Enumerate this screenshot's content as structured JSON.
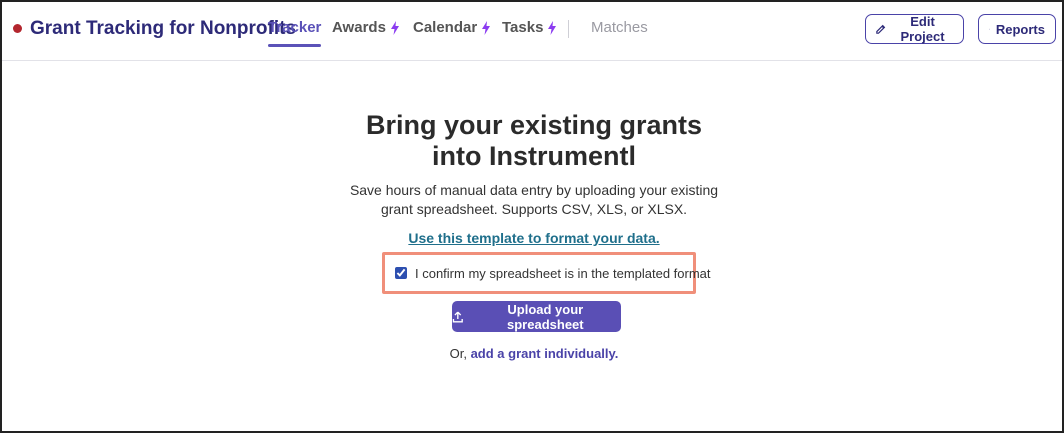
{
  "header": {
    "brand_title": "Grant Tracking for Nonprofits",
    "brand_dot_color": "#b3262e",
    "tabs": [
      {
        "label": "Tracker",
        "active": true,
        "bolt": false
      },
      {
        "label": "Awards",
        "active": false,
        "bolt": true
      },
      {
        "label": "Calendar",
        "active": false,
        "bolt": true
      },
      {
        "label": "Tasks",
        "active": false,
        "bolt": true
      },
      {
        "label": "Matches",
        "active": false,
        "bolt": false,
        "disabled": true
      }
    ],
    "edit_project_label": "Edit Project",
    "reports_label": "Reports"
  },
  "main": {
    "headline_line1": "Bring your existing grants",
    "headline_line2": "into Instrumentl",
    "desc_line1": "Save hours of manual data entry by uploading your existing",
    "desc_line2": "grant spreadsheet. Supports CSV, XLS, or XLSX.",
    "template_link": "Use this template to format your data.",
    "confirm_label": "I confirm my spreadsheet is in the templated format",
    "confirm_checked": true,
    "upload_label": "Upload your spreadsheet",
    "or_prefix": "Or,",
    "add_individually_link": "add a grant individually."
  },
  "colors": {
    "accent": "#5b52b8",
    "bolt": "#8b3cf0",
    "highlight_border": "#f08f7a",
    "link_teal": "#1f6f8b"
  }
}
